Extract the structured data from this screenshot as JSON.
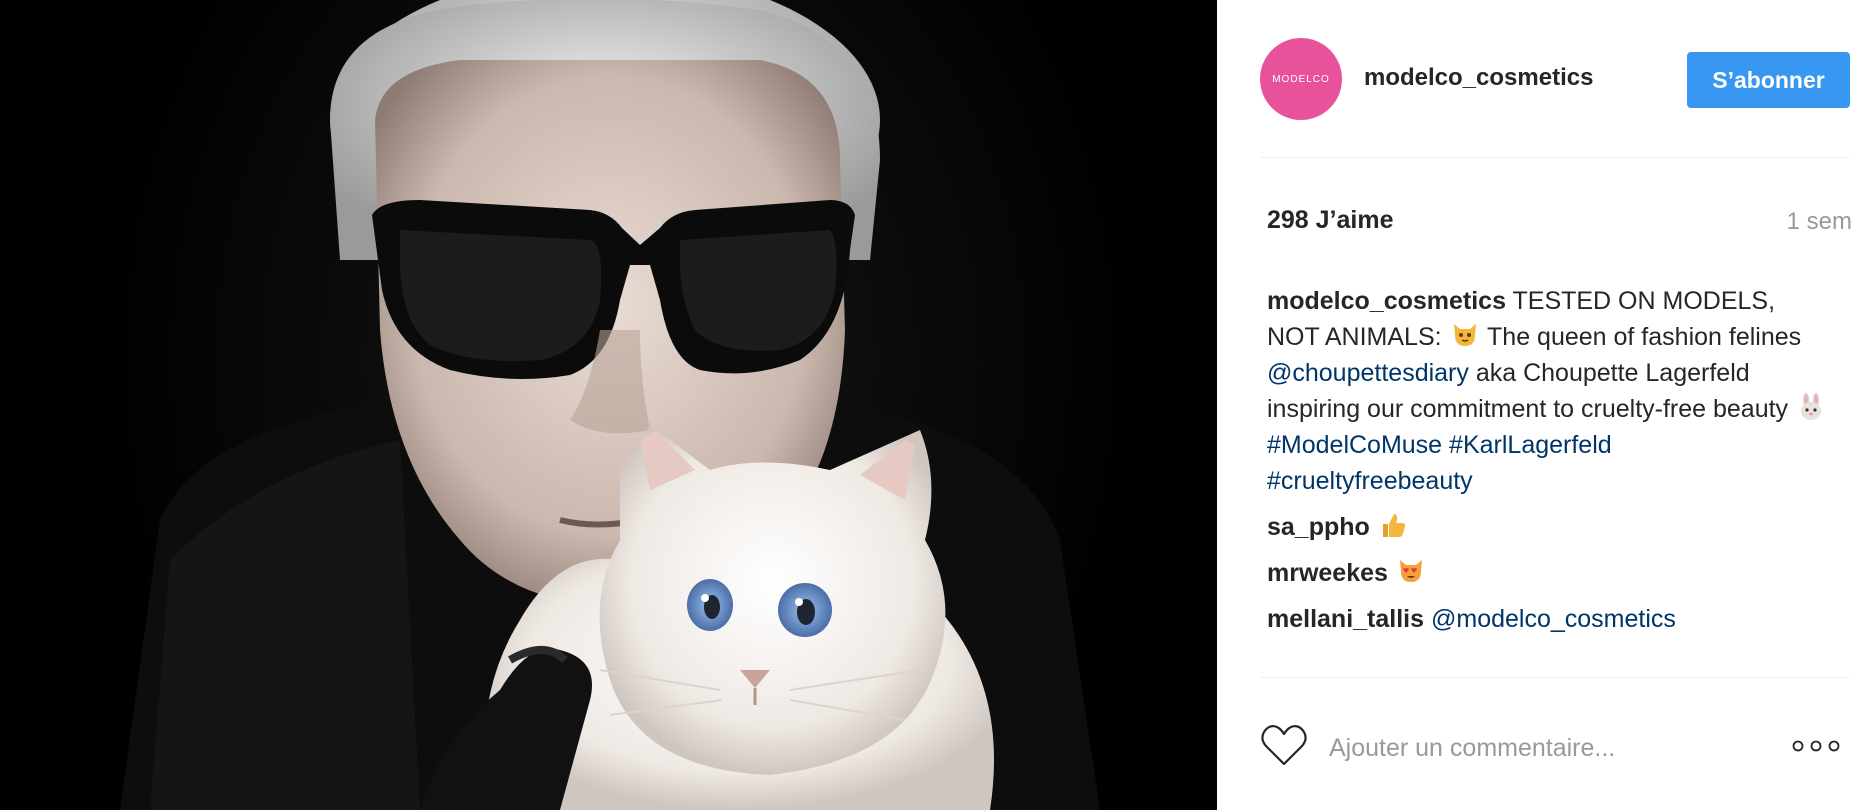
{
  "header": {
    "avatar_text": "MODELCO",
    "username": "modelco_cosmetics",
    "follow_label": "S’abonner"
  },
  "stats": {
    "likes": "298 J’aime",
    "time": "1 sem"
  },
  "caption": {
    "user": "modelco_cosmetics",
    "text1": " TESTED ON MODELS, NOT ANIMALS: ",
    "emoji1": "cat-face-icon",
    "text2": " The queen of fashion felines ",
    "mention": "@choupettesdiary",
    "text3": " aka Choupette Lagerfeld inspiring our commitment to cruelty-free beauty ",
    "emoji2": "rabbit-face-icon",
    "hashtag1": "#ModelCoMuse",
    "hashtag2": "#KarlLagerfeld",
    "hashtag3": "#crueltyfreebeauty"
  },
  "comments": [
    {
      "user": "sa_ppho",
      "text": "",
      "emoji": "thumbs-up-icon"
    },
    {
      "user": "mrweekes",
      "text": "",
      "emoji": "heart-eyes-cat-icon"
    },
    {
      "user": "mellani_tallis",
      "text": "@modelco_cosmetics",
      "emoji": ""
    }
  ],
  "footer": {
    "comment_placeholder": "Ajouter un commentaire...",
    "like_icon": "heart-outline-icon",
    "more_icon": "more-options-icon"
  },
  "colors": {
    "accent": "#3897f0",
    "avatar_bg": "#e8529b",
    "link": "#003569",
    "muted": "#999999"
  }
}
